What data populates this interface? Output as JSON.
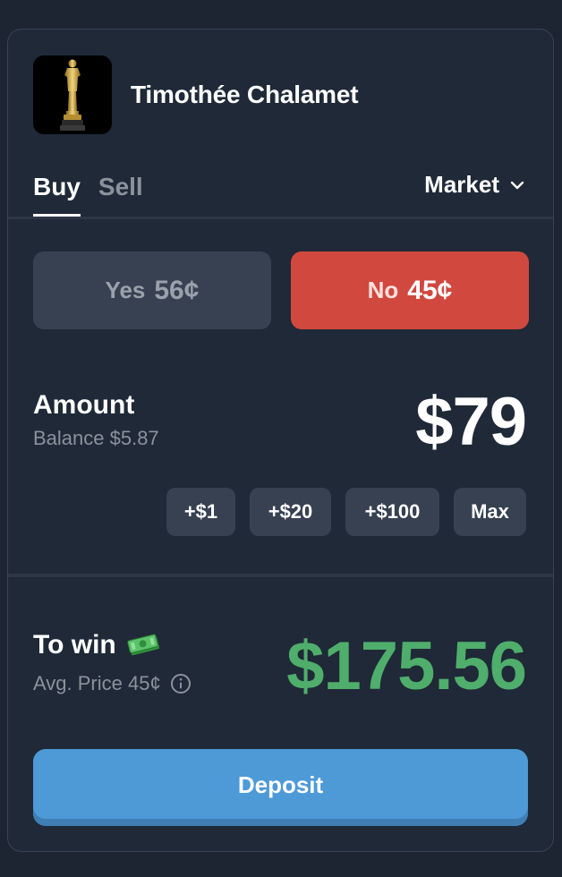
{
  "header": {
    "title": "Timothée Chalamet",
    "avatar_icon": "oscar-statuette-icon"
  },
  "tabs": [
    {
      "label": "Buy",
      "active": true
    },
    {
      "label": "Sell",
      "active": false
    }
  ],
  "order_type": {
    "label": "Market",
    "icon": "chevron-down-icon"
  },
  "outcomes": {
    "yes": {
      "label": "Yes",
      "price": "56¢"
    },
    "no": {
      "label": "No",
      "price": "45¢",
      "selected": true
    }
  },
  "amount": {
    "label": "Amount",
    "balance": "Balance $5.87",
    "value": "$79"
  },
  "quick_add": [
    "+$1",
    "+$20",
    "+$100",
    "Max"
  ],
  "to_win": {
    "label": "To win",
    "icon": "money-icon",
    "avg_price": "Avg. Price 45¢",
    "info_icon": "info-icon",
    "value": "$175.56"
  },
  "deposit_label": "Deposit",
  "colors": {
    "background": "#1f2937",
    "no_button": "#d1483e",
    "yes_button": "#374151",
    "win_green": "#4fae6b",
    "deposit_blue": "#4d9ad7"
  }
}
